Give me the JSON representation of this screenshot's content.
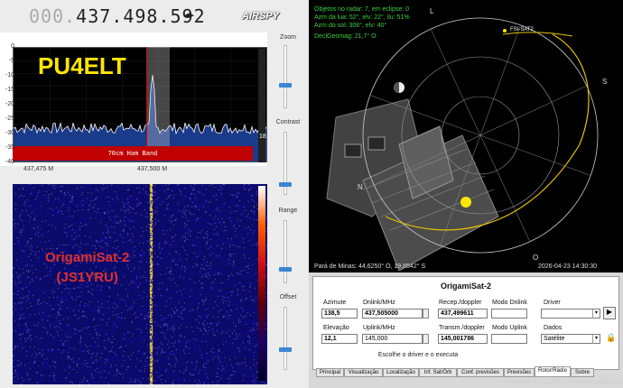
{
  "sdr": {
    "frequency_dim": "000.",
    "frequency_main": "437.498.592",
    "freq_arrows": "◂▸",
    "logo": "AIRSPY",
    "callsign": "PU4ELT",
    "hamband_label": "70cm Ham Band",
    "signal_value": "18",
    "waterfall_label_1": "OrigamiSat-2",
    "waterfall_label_2": "(JS1YRU)",
    "y_ticks": [
      "0",
      "-5",
      "-10",
      "-15",
      "-20",
      "-25",
      "-30",
      "-35",
      "-40"
    ],
    "x_ticks": [
      "437,475 M",
      "437,500 M"
    ],
    "side": {
      "zoom": "Zoom",
      "contrast": "Contrast",
      "range": "Range",
      "offset": "Offset"
    },
    "colors": {
      "trace": "#ffffff",
      "fill": "#1a3a8a",
      "hamband": "#c00000",
      "callsign": "#ffe600",
      "wf_label": "#e03030"
    }
  },
  "orbitron": {
    "info": [
      "Objetos no radar: 7, em eclipse: 0",
      "Azm da lua: 52°, elv: 22°, ilu: 51%",
      "Azm do sol: 308°, elv: 40°",
      "DeclGeomag: 21,7° O"
    ],
    "compass": {
      "north": "N",
      "south": "S",
      "east": "L",
      "west": "O"
    },
    "sat_radar_label": "FSI-SAT2",
    "location": "Pará de Minas: 44,6250° O, 19,8542° S",
    "datetime": "2026-04-23 14:30:30",
    "satellite_name": "OrigamiSat-2",
    "fields": {
      "azimute_label": "Azimute",
      "azimute": "138,5",
      "dnlink_label": "Dnlink/MHz",
      "dnlink": "437,505000",
      "recep_label": "Recep./doppler",
      "recep": "437,499611",
      "modo_dnlink_label": "Modo Dnlink",
      "modo_dnlink": "",
      "elevacao_label": "Elevação",
      "elevacao": "12,1",
      "uplink_label": "Uplink/MHz",
      "uplink": "145,000",
      "transm_label": "Transm./doppler",
      "transm": "145,001786",
      "modo_uplink_label": "Modo Uplink",
      "modo_uplink": "",
      "driver_label": "Driver",
      "driver": "",
      "dados_label": "Dados",
      "dados": "Satélite"
    },
    "hint": "Escolhe o driver e o executa",
    "tabs": [
      "Principal",
      "Visualização",
      "Localização",
      "Inf. Sat/Órb",
      "Conf. previsões",
      "Previsões",
      "Rotor/Rádio",
      "Sobre"
    ],
    "footer": "Orbitron 3.71 - (C) 2001-2005 by Sebastian Stoff"
  }
}
